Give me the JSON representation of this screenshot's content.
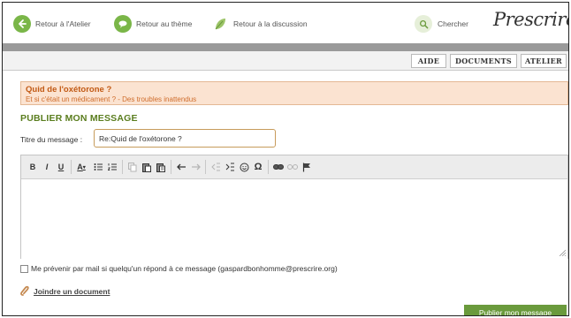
{
  "nav": {
    "back_atelier": "Retour à l'Atelier",
    "back_theme": "Retour au thème",
    "back_discussion": "Retour à la discussion",
    "search": "Chercher",
    "logo": "Prescrire"
  },
  "tabs": [
    "AIDE",
    "DOCUMENTS",
    "ATELIER"
  ],
  "topic": {
    "title": "Quid de l'oxétorone ?",
    "subtitle": "Et si c'était un médicament ? - Des troubles inattendus"
  },
  "form": {
    "section_title": "PUBLIER MON MESSAGE",
    "title_label": "Titre du message :",
    "title_value": "Re:Quid de l'oxétorone ?",
    "notify_label": "Me prévenir par mail si quelqu'un répond à ce message (gaspardbonhomme@prescrire.org)",
    "attach_label": "Joindre un document",
    "publish_label": "Publier mon message"
  },
  "toolbar": {
    "bold": "B",
    "italic": "I",
    "underline": "U",
    "font_color": "A",
    "special_char": "Ω"
  },
  "colors": {
    "accent_green": "#6a9a3c",
    "topic_bg": "#fbe3d1",
    "topic_text": "#c25a15"
  }
}
